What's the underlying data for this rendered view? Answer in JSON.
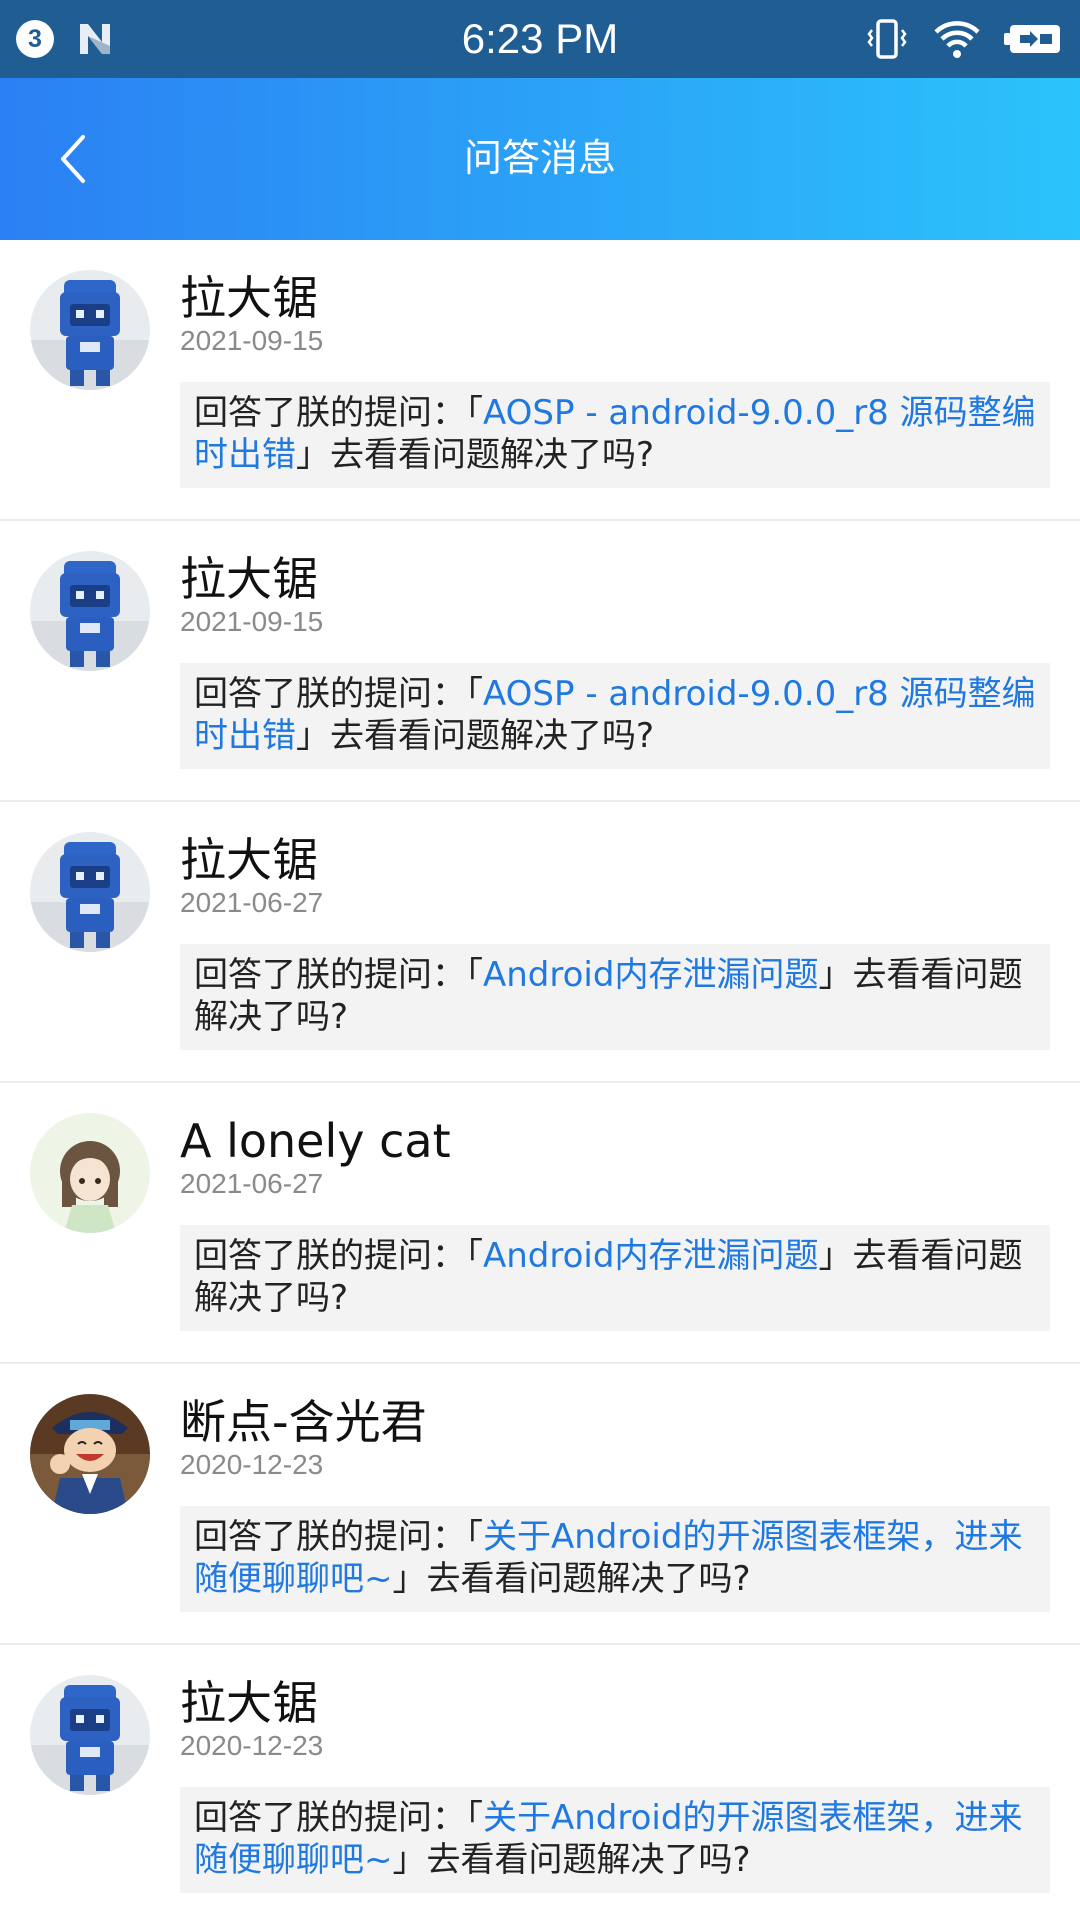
{
  "status_bar": {
    "notification_count": "3",
    "time": "6:23 PM"
  },
  "header": {
    "title": "问答消息"
  },
  "colors": {
    "header_gradient_start": "#2b80f3",
    "header_gradient_end": "#2bc3fb",
    "status_bar": "#1f5d93",
    "link": "#1f79e0",
    "message_bg": "#f3f3f3"
  },
  "items": [
    {
      "user": "拉大锯",
      "date": "2021-09-15",
      "prefix": "回答了朕的提问：「",
      "question": "AOSP - android-9.0.0_r8 源码整编时出错",
      "suffix": "」去看看问题解决了吗?",
      "avatar": "robot-avatar"
    },
    {
      "user": "拉大锯",
      "date": "2021-09-15",
      "prefix": "回答了朕的提问：「",
      "question": "AOSP - android-9.0.0_r8 源码整编时出错",
      "suffix": "」去看看问题解决了吗?",
      "avatar": "robot-avatar"
    },
    {
      "user": "拉大锯",
      "date": "2021-06-27",
      "prefix": "回答了朕的提问：「",
      "question": "Android内存泄漏问题",
      "suffix": "」去看看问题解决了吗?",
      "avatar": "robot-avatar"
    },
    {
      "user": "A lonely cat",
      "date": "2021-06-27",
      "prefix": "回答了朕的提问：「",
      "question": "Android内存泄漏问题",
      "suffix": "」去看看问题解决了吗?",
      "avatar": "girl-avatar"
    },
    {
      "user": "断点-含光君",
      "date": "2020-12-23",
      "prefix": "回答了朕的提问：「",
      "question": "关于Android的开源图表框架，进来随便聊聊吧~",
      "suffix": "」去看看问题解决了吗?",
      "avatar": "cartoon-boy-avatar"
    },
    {
      "user": "拉大锯",
      "date": "2020-12-23",
      "prefix": "回答了朕的提问：「",
      "question": "关于Android的开源图表框架，进来随便聊聊吧~",
      "suffix": "」去看看问题解决了吗?",
      "avatar": "robot-avatar"
    }
  ]
}
